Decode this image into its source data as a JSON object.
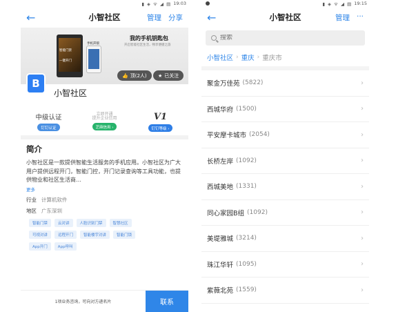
{
  "left": {
    "status_time": "19:03",
    "status_icons": "▮ ◈ ᯤ ◢ ▤",
    "nav": {
      "title": "小智社区",
      "manage": "管理",
      "share": "分享"
    },
    "banner": {
      "title": "我的手机钥匙包",
      "subtitle": "开启智能社区生活，畅享便捷之旅",
      "label_door": "智能门禁",
      "label_unlock": "手机开锁",
      "label_btn": "一键开门",
      "like": "顶(2人)",
      "follow": "已关注"
    },
    "company": {
      "logo_char": "B",
      "name": "小智社区"
    },
    "stats": [
      {
        "big": "中级认证",
        "chip": "钉钉认证"
      },
      {
        "small1": "立即开通",
        "small2": "提升企业信用",
        "chip": "芝麻信用 ›"
      },
      {
        "big": "V1",
        "chip": "钉钉等级 ›"
      }
    ],
    "intro": {
      "heading": "简介",
      "desc": "小智社区是一款提供智能生活服务的手机应用。小智社区为广大用户提供远程开门，智能门控，开门记录查询等工具功能，也提供物业和社区生活商…",
      "more": "更多"
    },
    "fields": [
      {
        "key": "行业",
        "value": "计算机软件"
      },
      {
        "key": "地区",
        "value": "广东深圳"
      }
    ],
    "tags": [
      "智能门禁",
      "云对讲",
      "人脸识别门禁",
      "智慧社区",
      "可视对讲",
      "远程开门",
      "智能楼宇对讲",
      "智能门锁",
      "App开门",
      "App呼叫"
    ],
    "footer": {
      "note": "1项业务咨询，可向对方递名片",
      "cta": "联系"
    }
  },
  "right": {
    "status_time": "19:15",
    "status_icons": "▮ ◈ ᯤ ◢ ▤",
    "nav": {
      "title": "小智社区",
      "manage": "管理",
      "more": "···"
    },
    "search": {
      "placeholder": "搜索"
    },
    "breadcrumb": [
      "小智社区",
      "重庆",
      "重庆市"
    ],
    "items": [
      {
        "name": "聚金万佳苑",
        "count": "(5822)"
      },
      {
        "name": "西城华府",
        "count": "(1500)"
      },
      {
        "name": "平安摩卡城市",
        "count": "(2054)"
      },
      {
        "name": "长桥左岸",
        "count": "(1092)"
      },
      {
        "name": "西城美地",
        "count": "(1331)"
      },
      {
        "name": "同心家园B组",
        "count": "(1092)"
      },
      {
        "name": "美堤雅城",
        "count": "(3214)"
      },
      {
        "name": "珠江华轩",
        "count": "(1095)"
      },
      {
        "name": "紫薇北苑",
        "count": "(1559)"
      }
    ]
  }
}
